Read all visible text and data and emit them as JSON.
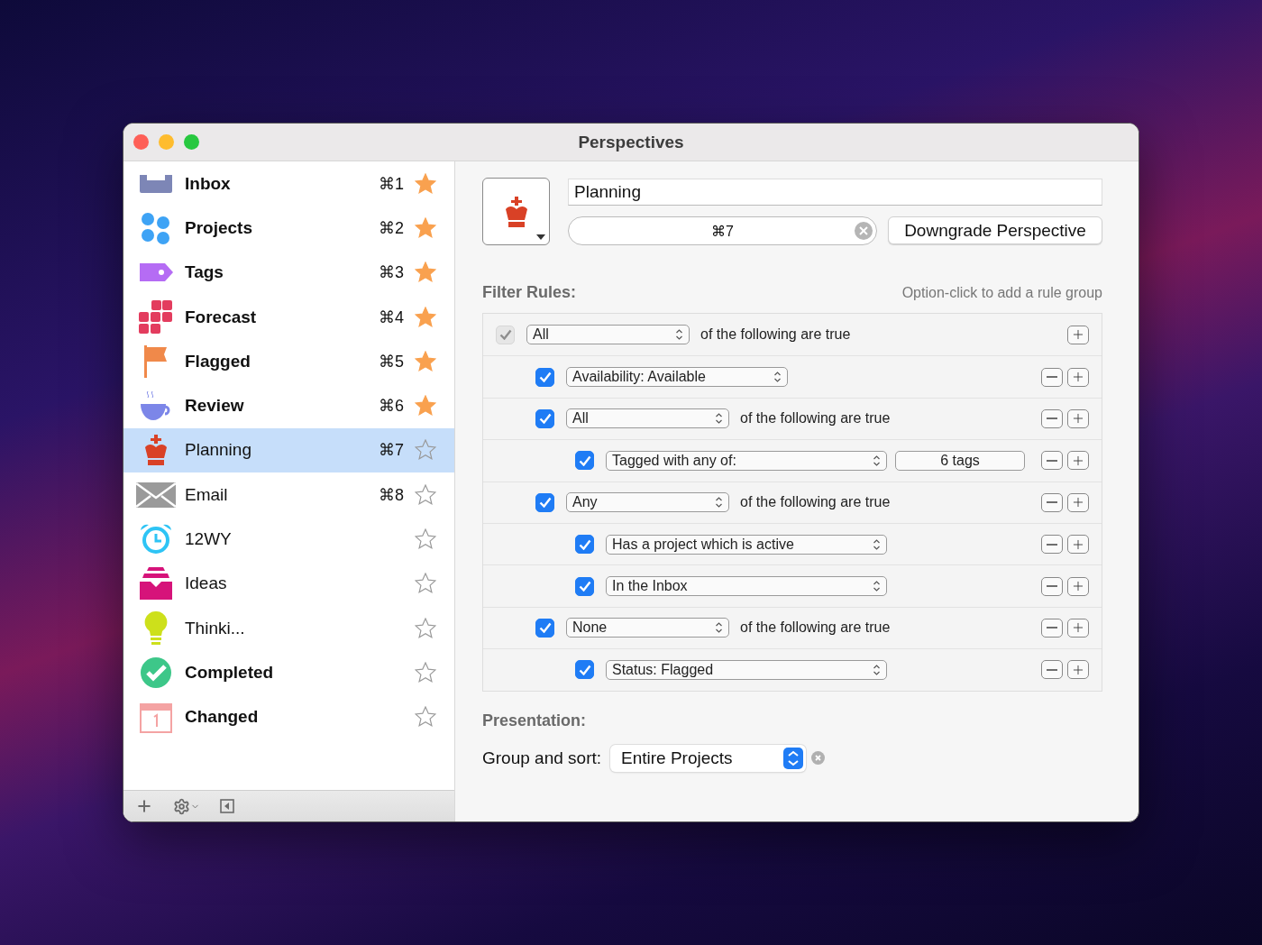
{
  "window": {
    "title": "Perspectives"
  },
  "sidebar": {
    "items": [
      {
        "label": "Inbox",
        "shortcut": "⌘1",
        "starred": true,
        "bold": true,
        "selected": false
      },
      {
        "label": "Projects",
        "shortcut": "⌘2",
        "starred": true,
        "bold": true,
        "selected": false
      },
      {
        "label": "Tags",
        "shortcut": "⌘3",
        "starred": true,
        "bold": true,
        "selected": false
      },
      {
        "label": "Forecast",
        "shortcut": "⌘4",
        "starred": true,
        "bold": true,
        "selected": false
      },
      {
        "label": "Flagged",
        "shortcut": "⌘5",
        "starred": true,
        "bold": true,
        "selected": false
      },
      {
        "label": "Review",
        "shortcut": "⌘6",
        "starred": true,
        "bold": true,
        "selected": false
      },
      {
        "label": "Planning",
        "shortcut": "⌘7",
        "starred": false,
        "bold": false,
        "selected": true
      },
      {
        "label": "Email",
        "shortcut": "⌘8",
        "starred": false,
        "bold": false,
        "selected": false
      },
      {
        "label": "12WY",
        "starred": false,
        "bold": false,
        "selected": false
      },
      {
        "label": "Ideas",
        "starred": false,
        "bold": false,
        "selected": false
      },
      {
        "label": "Thinki...",
        "starred": false,
        "bold": false,
        "selected": false
      },
      {
        "label": "Completed",
        "starred": false,
        "bold": true,
        "selected": false
      },
      {
        "label": "Changed",
        "starred": false,
        "bold": true,
        "selected": false
      }
    ]
  },
  "editor": {
    "name": "Planning",
    "shortcut": "⌘7",
    "downgrade_button": "Downgrade Perspective",
    "filter_rules": {
      "title": "Filter Rules:",
      "hint": "Option-click to add a rule group",
      "root": {
        "kind": "group",
        "checked": true,
        "disabled": true,
        "removable": false,
        "match": "All",
        "text": "of the following are true",
        "children": [
          {
            "kind": "condition",
            "checked": true,
            "disabled": false,
            "removable": true,
            "rule": "Availability: Available"
          },
          {
            "kind": "group",
            "checked": true,
            "disabled": false,
            "removable": true,
            "match": "All",
            "text": "of the following are true",
            "children": [
              {
                "kind": "condition",
                "checked": true,
                "disabled": false,
                "removable": true,
                "rule": "Tagged with any of:",
                "value": "6 tags"
              }
            ]
          },
          {
            "kind": "group",
            "checked": true,
            "disabled": false,
            "removable": true,
            "match": "Any",
            "text": "of the following are true",
            "children": [
              {
                "kind": "condition",
                "checked": true,
                "disabled": false,
                "removable": true,
                "rule": "Has a project which is active"
              },
              {
                "kind": "condition",
                "checked": true,
                "disabled": false,
                "removable": true,
                "rule": "In the Inbox"
              }
            ]
          },
          {
            "kind": "group",
            "checked": true,
            "disabled": false,
            "removable": true,
            "match": "None",
            "text": "of the following are true",
            "children": [
              {
                "kind": "condition",
                "checked": true,
                "disabled": false,
                "removable": true,
                "rule": "Status: Flagged"
              }
            ]
          }
        ]
      }
    },
    "presentation": {
      "title": "Presentation:",
      "group_and_sort": {
        "label": "Group and sort:",
        "value": "Entire Projects"
      }
    }
  }
}
